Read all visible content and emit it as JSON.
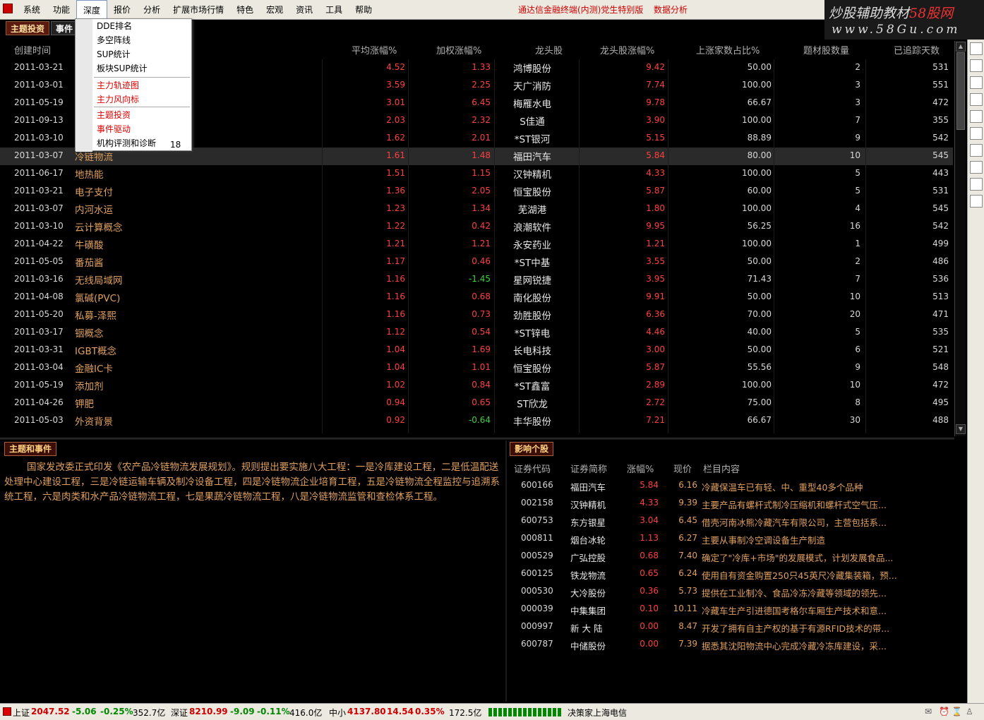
{
  "menubar": {
    "items": [
      "系统",
      "功能",
      "深度",
      "报价",
      "分析",
      "扩展市场行情",
      "特色",
      "宏观",
      "资讯",
      "工具",
      "帮助"
    ],
    "title": "通达信金融终端(内测)党生特别版",
    "title2": "数据分析"
  },
  "watermark": {
    "line1": "炒股辅助教材",
    "line1b": "58股网",
    "line2": "www.58Gu.com"
  },
  "tabs": {
    "tab1": "主题投资",
    "tab2": "事件"
  },
  "dropdown": {
    "items": [
      "DDE排名",
      "多空阵线",
      "SUP统计",
      "板块SUP统计",
      "主力轨迹图",
      "主力风向标",
      "主题投资",
      "事件驱动",
      "机构评测和诊断"
    ],
    "num": "18"
  },
  "table": {
    "headers": [
      "创建时间",
      "平均涨幅%",
      "加权涨幅%",
      "龙头股",
      "龙头股涨幅%",
      "上涨家数占比%",
      "题材股数量",
      "已追踪天数"
    ],
    "rows": [
      {
        "date": "2011-03-21",
        "name": "",
        "avg": "4.52",
        "wt": "1.33",
        "lead": "鸿博股份",
        "lchg": "9.42",
        "ratio": "50.00",
        "cnt": "2",
        "days": "531"
      },
      {
        "date": "2011-03-01",
        "name": "",
        "avg": "3.59",
        "wt": "2.25",
        "lead": "天广消防",
        "lchg": "7.74",
        "ratio": "100.00",
        "cnt": "3",
        "days": "551"
      },
      {
        "date": "2011-05-19",
        "name": "",
        "avg": "3.01",
        "wt": "6.45",
        "lead": "梅雁水电",
        "lchg": "9.78",
        "ratio": "66.67",
        "cnt": "3",
        "days": "472"
      },
      {
        "date": "2011-09-13",
        "name": "",
        "avg": "2.03",
        "wt": "2.32",
        "lead": "S佳通",
        "lchg": "3.90",
        "ratio": "100.00",
        "cnt": "7",
        "days": "355"
      },
      {
        "date": "2011-03-10",
        "name": "",
        "avg": "1.62",
        "wt": "2.01",
        "lead": "*ST银河",
        "lchg": "5.15",
        "ratio": "88.89",
        "cnt": "9",
        "days": "542"
      },
      {
        "date": "2011-03-07",
        "name": "冷链物流",
        "avg": "1.61",
        "wt": "1.48",
        "lead": "福田汽车",
        "lchg": "5.84",
        "ratio": "80.00",
        "cnt": "10",
        "days": "545"
      },
      {
        "date": "2011-06-17",
        "name": "地热能",
        "avg": "1.51",
        "wt": "1.15",
        "lead": "汉钟精机",
        "lchg": "4.33",
        "ratio": "100.00",
        "cnt": "5",
        "days": "443"
      },
      {
        "date": "2011-03-21",
        "name": "电子支付",
        "avg": "1.36",
        "wt": "2.05",
        "lead": "恒宝股份",
        "lchg": "5.87",
        "ratio": "60.00",
        "cnt": "5",
        "days": "531"
      },
      {
        "date": "2011-03-07",
        "name": "内河水运",
        "avg": "1.23",
        "wt": "1.34",
        "lead": "芜湖港",
        "lchg": "1.80",
        "ratio": "100.00",
        "cnt": "4",
        "days": "545"
      },
      {
        "date": "2011-03-10",
        "name": "云计算概念",
        "avg": "1.22",
        "wt": "0.42",
        "lead": "浪潮软件",
        "lchg": "9.95",
        "ratio": "56.25",
        "cnt": "16",
        "days": "542"
      },
      {
        "date": "2011-04-22",
        "name": "牛磺酸",
        "avg": "1.21",
        "wt": "1.21",
        "lead": "永安药业",
        "lchg": "1.21",
        "ratio": "100.00",
        "cnt": "1",
        "days": "499"
      },
      {
        "date": "2011-05-05",
        "name": "番茄酱",
        "avg": "1.17",
        "wt": "0.46",
        "lead": "*ST中基",
        "lchg": "3.55",
        "ratio": "50.00",
        "cnt": "2",
        "days": "486"
      },
      {
        "date": "2011-03-16",
        "name": "无线局域网",
        "avg": "1.16",
        "wt": "-1.45",
        "lead": "星网锐捷",
        "lchg": "3.95",
        "ratio": "71.43",
        "cnt": "7",
        "days": "536"
      },
      {
        "date": "2011-04-08",
        "name": "氯碱(PVC)",
        "avg": "1.16",
        "wt": "0.68",
        "lead": "南化股份",
        "lchg": "9.91",
        "ratio": "50.00",
        "cnt": "10",
        "days": "513"
      },
      {
        "date": "2011-05-20",
        "name": "私募-泽熙",
        "avg": "1.16",
        "wt": "0.73",
        "lead": "劲胜股份",
        "lchg": "6.36",
        "ratio": "70.00",
        "cnt": "20",
        "days": "471"
      },
      {
        "date": "2011-03-17",
        "name": "铟概念",
        "avg": "1.12",
        "wt": "0.54",
        "lead": "*ST锌电",
        "lchg": "4.46",
        "ratio": "40.00",
        "cnt": "5",
        "days": "535"
      },
      {
        "date": "2011-03-31",
        "name": "IGBT概念",
        "avg": "1.04",
        "wt": "1.69",
        "lead": "长电科技",
        "lchg": "3.00",
        "ratio": "50.00",
        "cnt": "6",
        "days": "521"
      },
      {
        "date": "2011-03-04",
        "name": "金融IC卡",
        "avg": "1.04",
        "wt": "1.01",
        "lead": "恒宝股份",
        "lchg": "5.87",
        "ratio": "55.56",
        "cnt": "9",
        "days": "548"
      },
      {
        "date": "2011-05-19",
        "name": "添加剂",
        "avg": "1.02",
        "wt": "0.84",
        "lead": "*ST鑫富",
        "lchg": "2.89",
        "ratio": "100.00",
        "cnt": "10",
        "days": "472"
      },
      {
        "date": "2011-04-26",
        "name": "钾肥",
        "avg": "0.94",
        "wt": "0.65",
        "lead": "ST欣龙",
        "lchg": "2.72",
        "ratio": "75.00",
        "cnt": "8",
        "days": "495"
      },
      {
        "date": "2011-05-03",
        "name": "外资背景",
        "avg": "0.92",
        "wt": "-0.64",
        "lead": "丰华股份",
        "lchg": "7.21",
        "ratio": "66.67",
        "cnt": "30",
        "days": "488"
      }
    ]
  },
  "panels": {
    "topic": "主题和事件",
    "impact": "影响个股"
  },
  "topic_text": "国家发改委正式印发《农产品冷链物流发展规划》。规则提出要实施八大工程：一是冷库建设工程，二是低温配送处理中心建设工程，三是冷链运输车辆及制冷设备工程，四是冷链物流企业培育工程，五是冷链物流全程监控与追溯系统工程，六是肉类和水产品冷链物流工程，七是果蔬冷链物流工程，八是冷链物流监管和查检体系工程。",
  "impact": {
    "headers": [
      "证券代码",
      "证券简称",
      "涨幅%",
      "现价",
      "栏目内容"
    ],
    "rows": [
      {
        "code": "600166",
        "name": "福田汽车",
        "chg": "5.84",
        "price": "6.16",
        "text": "冷藏保温车已有轻、中、重型40多个品种"
      },
      {
        "code": "002158",
        "name": "汉钟精机",
        "chg": "4.33",
        "price": "9.39",
        "text": "主要产品有螺杆式制冷压缩机和螺杆式空气压..."
      },
      {
        "code": "600753",
        "name": "东方银星",
        "chg": "3.04",
        "price": "6.45",
        "text": "借壳河南冰熊冷藏汽车有限公司，主营包括系..."
      },
      {
        "code": "000811",
        "name": "烟台冰轮",
        "chg": "1.13",
        "price": "6.27",
        "text": "主要从事制冷空调设备生产制造"
      },
      {
        "code": "000529",
        "name": "广弘控股",
        "chg": "0.68",
        "price": "7.40",
        "text": "确定了\"冷库+市场\"的发展模式，计划发展食品..."
      },
      {
        "code": "600125",
        "name": "铁龙物流",
        "chg": "0.65",
        "price": "6.24",
        "text": "使用自有资金购置250只45英尺冷藏集装箱，预..."
      },
      {
        "code": "000530",
        "name": "大冷股份",
        "chg": "0.36",
        "price": "5.73",
        "text": "提供在工业制冷、食品冷冻冷藏等领域的领先..."
      },
      {
        "code": "000039",
        "name": "中集集团",
        "chg": "0.10",
        "price": "10.11",
        "text": "冷藏车生产引进德国考格尔车厢生产技术和意..."
      },
      {
        "code": "000997",
        "name": "新 大 陆",
        "chg": "0.00",
        "price": "8.47",
        "text": "开发了拥有自主产权的基于有源RFID技术的带..."
      },
      {
        "code": "600787",
        "name": "中储股份",
        "chg": "0.00",
        "price": "7.39",
        "text": "据悉其沈阳物流中心完成冷藏冷冻库建设，采..."
      }
    ]
  },
  "status": {
    "sh_label": "上证",
    "sh_val": "2047.52",
    "sh_chg": "-5.06",
    "sh_pct": "-0.25%",
    "sh_amt": "352.7亿",
    "sz_label": "深证",
    "sz_val": "8210.99",
    "sz_chg": "-9.09",
    "sz_pct": "-0.11%",
    "sz_amt": "416.0亿",
    "zx_label": "中小",
    "zx_val": "4137.80",
    "zx_chg": "14.54",
    "zx_pct": "0.35%",
    "zx_amt": "172.5亿",
    "broker": "决策家上海电信"
  }
}
